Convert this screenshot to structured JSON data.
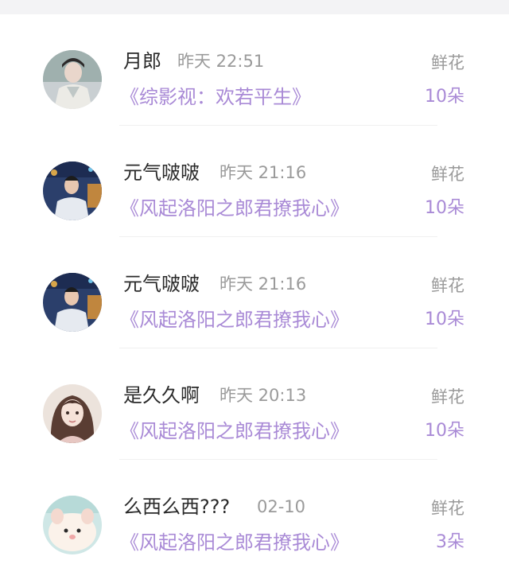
{
  "items": [
    {
      "name": "月郎",
      "time": "昨天 22:51",
      "title": "《综影视：欢若平生》",
      "gift_label": "鲜花",
      "gift_count": "10朵"
    },
    {
      "name": "元气啵啵",
      "time": "昨天 21:16",
      "title": "《风起洛阳之郎君撩我心》",
      "gift_label": "鲜花",
      "gift_count": "10朵"
    },
    {
      "name": "元气啵啵",
      "time": "昨天 21:16",
      "title": "《风起洛阳之郎君撩我心》",
      "gift_label": "鲜花",
      "gift_count": "10朵"
    },
    {
      "name": "是久久啊",
      "time": "昨天 20:13",
      "title": "《风起洛阳之郎君撩我心》",
      "gift_label": "鲜花",
      "gift_count": "10朵"
    },
    {
      "name": "么西么西???",
      "time": "02-10",
      "title": "《风起洛阳之郎君撩我心》",
      "gift_label": "鲜花",
      "gift_count": "3朵"
    }
  ],
  "colors": {
    "accent": "#a98ad6",
    "muted": "#9a9a9a",
    "text": "#2a2a2a"
  }
}
